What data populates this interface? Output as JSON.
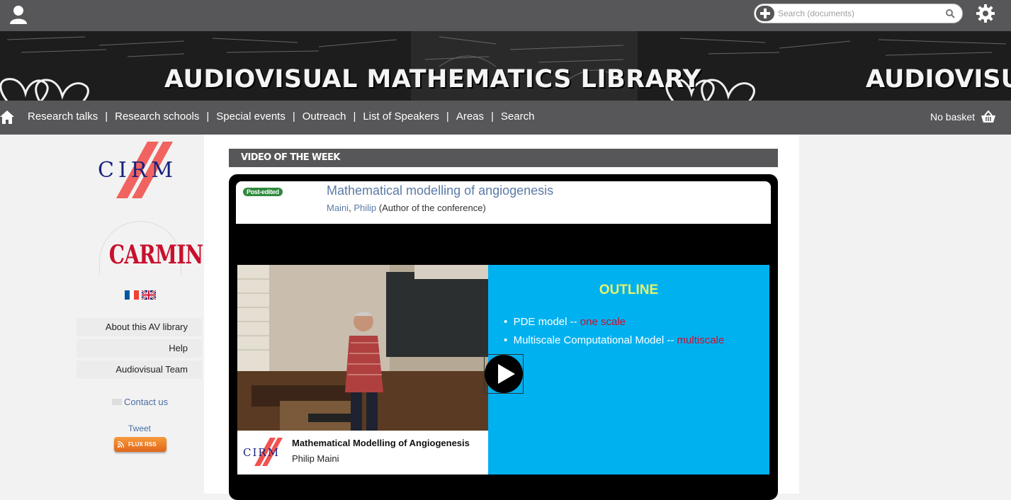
{
  "topbar": {
    "search_placeholder": "Search (documents)",
    "icons": [
      "user-icon",
      "add-icon",
      "search-icon",
      "gear-icon"
    ]
  },
  "banner": {
    "title": "AUDIOVISUAL MATHEMATICS LIBRARY",
    "title_repeat": "AUDIOVISU"
  },
  "nav": {
    "items": [
      "Research talks",
      "Research schools",
      "Special events",
      "Outreach",
      "List of Speakers",
      "Areas",
      "Search"
    ],
    "separator": "|",
    "basket": "No basket"
  },
  "sidebar": {
    "cirm_logo": "CIRM",
    "carmin_logo": "CARMIN",
    "languages": [
      "fr-flag-icon",
      "uk-flag-icon"
    ],
    "links": [
      "About this AV library",
      "Help",
      "Audiovisual Team"
    ],
    "contact": "Contact us",
    "tweet": "Tweet",
    "rss": "FLUX RSS"
  },
  "content": {
    "section_title": "VIDEO OF THE WEEK",
    "badge": "Post-edited",
    "talk_title": "Mathematical modelling of angiogenesis",
    "author_last": "Maini",
    "author_first": "Philip",
    "author_role": "(Author of the conference)",
    "video": {
      "caption_logo": "CIRM",
      "caption_title": "Mathematical Modelling of Angiogenesis",
      "caption_speaker": "Philip Maini",
      "slide_heading": "OUTLINE",
      "bullet1_text": "PDE model  -- ",
      "bullet1_red": "one scale",
      "bullet2_text": "Multiscale Computational Model -- ",
      "bullet2_red": "multiscale"
    }
  },
  "colors": {
    "bar": "#575759",
    "link": "#5a7aa6",
    "slide_bg": "#00b1f0",
    "badge": "#2f8a3c"
  }
}
